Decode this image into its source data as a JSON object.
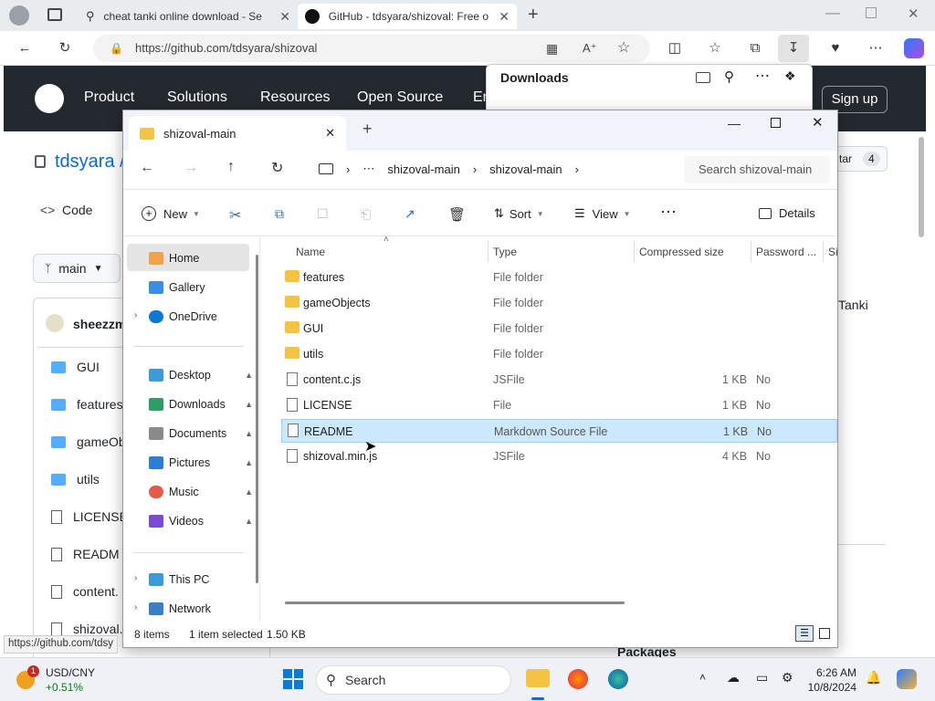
{
  "browser": {
    "tabs": [
      {
        "title": "cheat tanki online download - Se"
      },
      {
        "title": "GitHub - tdsyara/shizoval: Free o"
      }
    ],
    "url": "https://github.com/tdsyara/shizoval",
    "status_url": "https://github.com/tdsy"
  },
  "github": {
    "nav": [
      "Product",
      "Solutions",
      "Resources",
      "Open Source",
      "En"
    ],
    "signup": "Sign up",
    "owner": "tdsyara /",
    "code_tab": "Code",
    "branch": "main",
    "user": "sheezzm",
    "star_label": "tar",
    "star_count": "4",
    "about_snippet": "Tanki",
    "packages": "Packages",
    "files": [
      "GUI",
      "features",
      "gameObj",
      "utils",
      "LICENSE",
      "READM",
      "content.",
      "shizoval."
    ]
  },
  "downloads": {
    "title": "Downloads"
  },
  "explorer": {
    "tab_title": "shizoval-main",
    "breadcrumb": [
      "shizoval-main",
      "shizoval-main"
    ],
    "search_placeholder": "Search shizoval-main",
    "toolbar": {
      "new": "New",
      "sort": "Sort",
      "view": "View",
      "details": "Details"
    },
    "sidebar": {
      "top": [
        {
          "label": "Home",
          "icon": "home-icon"
        },
        {
          "label": "Gallery",
          "icon": "gallery-icon"
        },
        {
          "label": "OneDrive",
          "icon": "onedrive-icon"
        }
      ],
      "pinned": [
        {
          "label": "Desktop",
          "icon": "desktop-icon"
        },
        {
          "label": "Downloads",
          "icon": "downloads-icon"
        },
        {
          "label": "Documents",
          "icon": "documents-icon"
        },
        {
          "label": "Pictures",
          "icon": "pictures-icon"
        },
        {
          "label": "Music",
          "icon": "music-icon"
        },
        {
          "label": "Videos",
          "icon": "videos-icon"
        }
      ],
      "bottom": [
        {
          "label": "This PC",
          "icon": "this-pc-icon"
        },
        {
          "label": "Network",
          "icon": "network-icon"
        }
      ]
    },
    "columns": {
      "name": "Name",
      "type": "Type",
      "compressed": "Compressed size",
      "password": "Password ...",
      "size": "Si"
    },
    "rows": [
      {
        "name": "features",
        "type": "File folder",
        "compressed": "",
        "password": "",
        "kind": "folder"
      },
      {
        "name": "gameObjects",
        "type": "File folder",
        "compressed": "",
        "password": "",
        "kind": "folder"
      },
      {
        "name": "GUI",
        "type": "File folder",
        "compressed": "",
        "password": "",
        "kind": "folder"
      },
      {
        "name": "utils",
        "type": "File folder",
        "compressed": "",
        "password": "",
        "kind": "folder"
      },
      {
        "name": "content.c.js",
        "type": "JSFile",
        "compressed": "1 KB",
        "password": "No",
        "kind": "file"
      },
      {
        "name": "LICENSE",
        "type": "File",
        "compressed": "1 KB",
        "password": "No",
        "kind": "file"
      },
      {
        "name": "README",
        "type": "Markdown Source File",
        "compressed": "1 KB",
        "password": "No",
        "kind": "file"
      },
      {
        "name": "shizoval.min.js",
        "type": "JSFile",
        "compressed": "4 KB",
        "password": "No",
        "kind": "file"
      }
    ],
    "status": {
      "items": "8 items",
      "selected": "1 item selected",
      "size": "1.50 KB"
    }
  },
  "taskbar": {
    "widget_label": "USD/CNY",
    "widget_value": "+0.51%",
    "widget_badge": "1",
    "search": "Search",
    "time": "6:26 AM",
    "date": "10/8/2024"
  }
}
